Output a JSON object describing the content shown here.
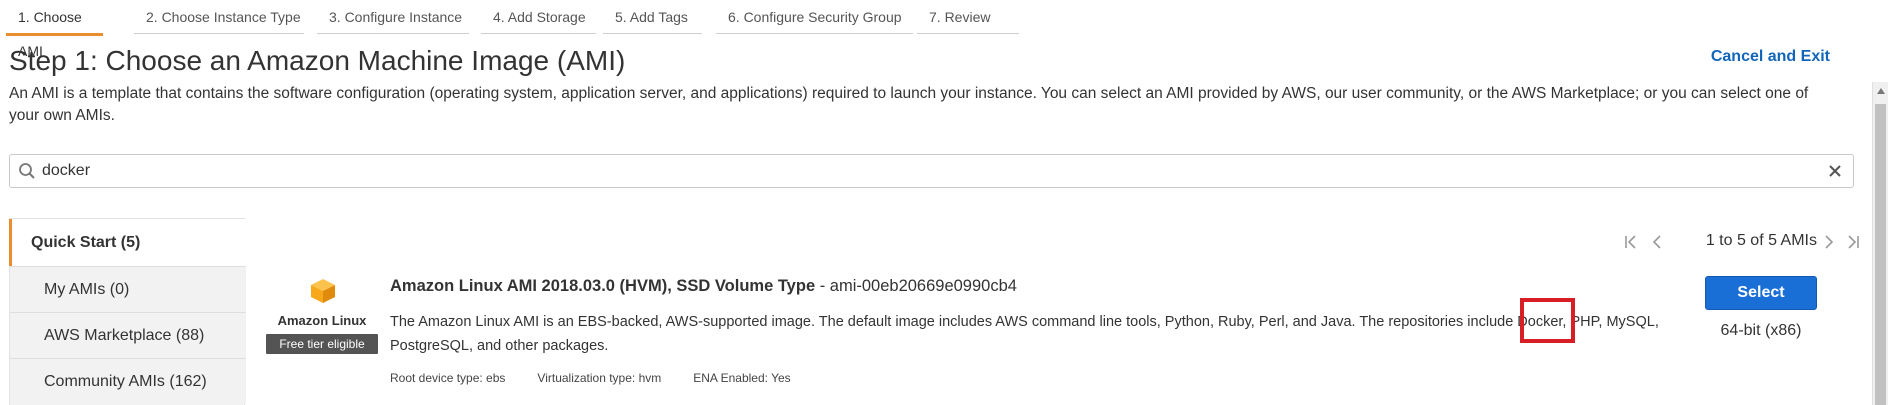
{
  "wizard": {
    "steps": [
      "1. Choose AMI",
      "2. Choose Instance Type",
      "3. Configure Instance",
      "4. Add Storage",
      "5. Add Tags",
      "6. Configure Security Group",
      "7. Review"
    ],
    "active_index": 0
  },
  "header": {
    "title": "Step 1: Choose an Amazon Machine Image (AMI)",
    "cancel_label": "Cancel and Exit",
    "description": "An AMI is a template that contains the software configuration (operating system, application server, and applications) required to launch your instance. You can select an AMI provided by AWS, our user community, or the AWS Marketplace; or you can select one of your own AMIs."
  },
  "search": {
    "value": "docker",
    "icon": "search-icon",
    "clear_icon": "close-icon"
  },
  "sidebar": {
    "items": [
      "Quick Start (5)",
      "My AMIs (0)",
      "AWS Marketplace (88)",
      "Community AMIs (162)"
    ]
  },
  "pagination": {
    "text": "1 to 5 of 5 AMIs"
  },
  "ami": {
    "vendor": "Amazon Linux",
    "badge": "Free tier eligible",
    "name": "Amazon Linux AMI 2018.03.0 (HVM), SSD Volume Type",
    "id_suffix": " - ami-00eb20669e0990cb4",
    "description": "The Amazon Linux AMI is an EBS-backed, AWS-supported image. The default image includes AWS command line tools, Python, Ruby, Perl, and Java. The repositories include Docker, PHP, MySQL, PostgreSQL, and other packages.",
    "root_device": "Root device type: ebs",
    "virtualization": "Virtualization type: hvm",
    "ena": "ENA Enabled: Yes",
    "select_label": "Select",
    "arch": "64-bit (x86)"
  },
  "colors": {
    "accent_orange": "#e88e2f",
    "link_blue": "#1166bb",
    "button_blue": "#1a6fd6",
    "highlight_red": "#d81f26",
    "logo_orange": "#f7a81b"
  }
}
